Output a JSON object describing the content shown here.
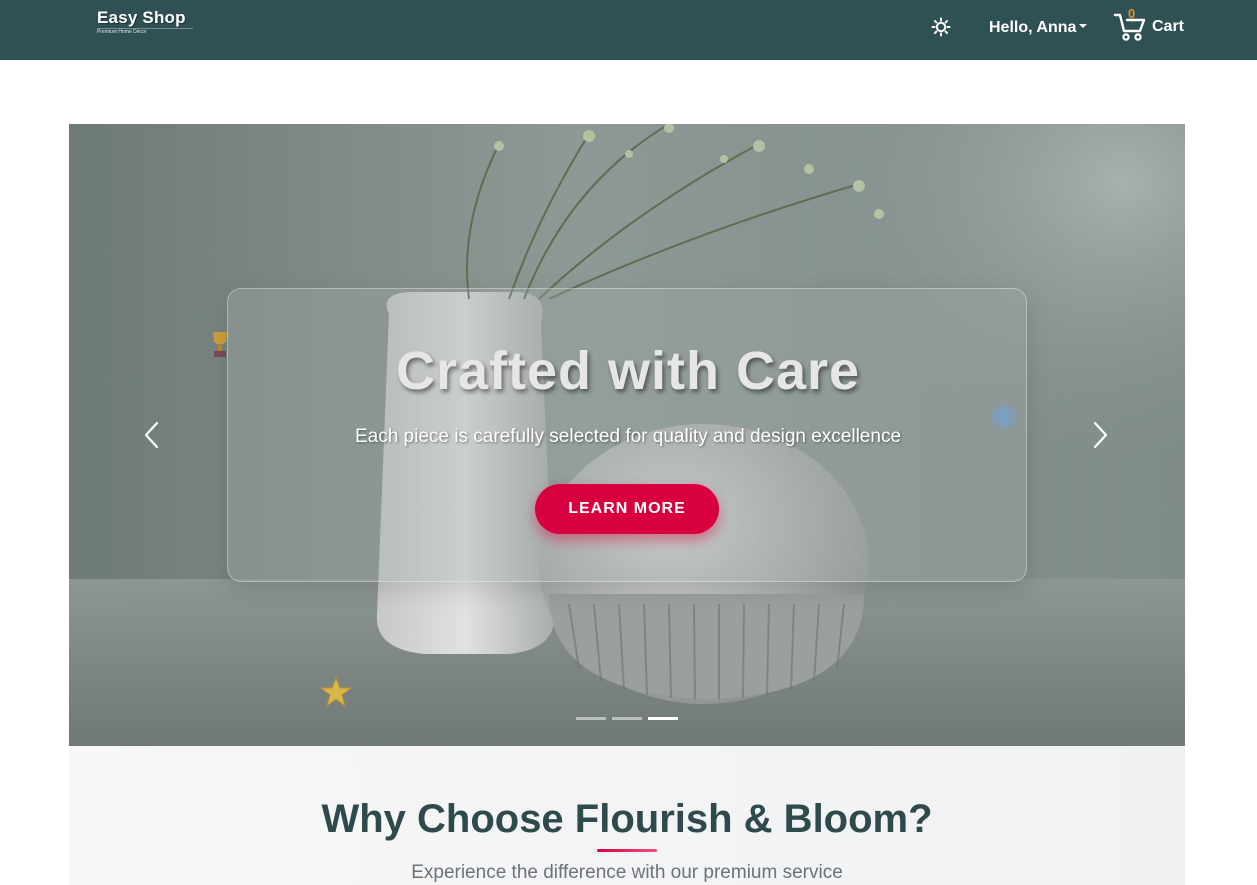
{
  "header": {
    "brand_name": "Easy Shop",
    "brand_tagline": "Premium Home Décor",
    "theme_icon": "sun-icon",
    "user_greeting": "Hello, Anna",
    "cart_count": "0",
    "cart_label": "Cart",
    "cart_icon": "shopping-cart-icon"
  },
  "hero": {
    "title": "Crafted with Care",
    "subtitle": "Each piece is carefully selected for quality and design excellence",
    "cta_label": "LEARN MORE",
    "prev_icon": "chevron-left-icon",
    "next_icon": "chevron-right-icon",
    "slide_count": 3,
    "active_slide": 3
  },
  "why": {
    "title": "Why Choose Flourish & Bloom?",
    "subtitle": "Experience the difference with our premium service"
  },
  "colors": {
    "navbar": "#2f5153",
    "accent": "#d9003f",
    "cart_count": "#f0902a",
    "heading": "#2f4a4c"
  }
}
